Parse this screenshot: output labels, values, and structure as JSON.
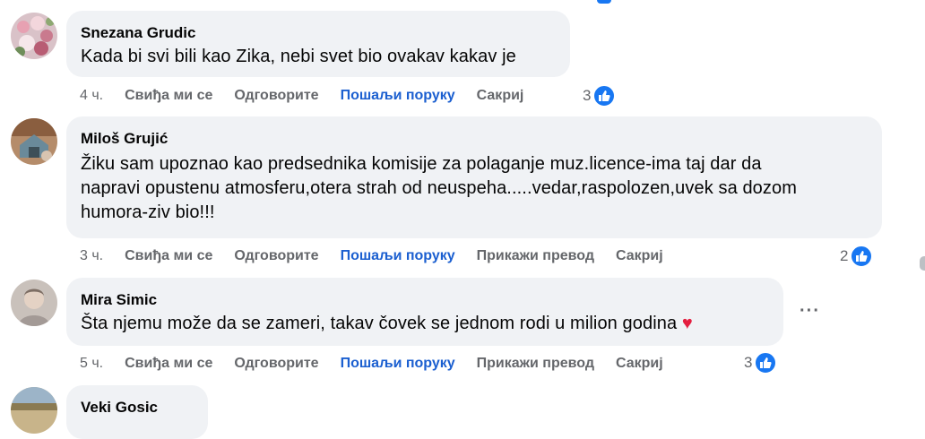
{
  "comments": [
    {
      "author": "Snezana Grudic",
      "text": "Kada bi svi bili kao Zika, nebi svet bio ovakav kakav je",
      "time": "4 ч.",
      "like": "Свиђа ми се",
      "reply": "Одговорите",
      "message": "Пошаљи поруку",
      "hide": "Сакриј",
      "reactions": "3"
    },
    {
      "author": "Miloš Grujić",
      "text_lines": [
        "Žiku sam upoznao kao predsednika komisije za polaganje muz.licence-ima taj dar da",
        "napravi opustenu atmosferu,otera strah od neuspeha.....vedar,raspolozen,uvek sa dozom",
        "humora-ziv bio!!!"
      ],
      "time": "3 ч.",
      "like": "Свиђа ми се",
      "reply": "Одговорите",
      "message": "Пошаљи поруку",
      "translate": "Прикажи превод",
      "hide": "Сакриј",
      "reactions": "2"
    },
    {
      "author": "Mira Simic",
      "text": "Šta njemu može da se zameri, takav čovek se jednom rodi u milion godina",
      "emoji": "♥",
      "time": "5 ч.",
      "like": "Свиђа ми се",
      "reply": "Одговорите",
      "message": "Пошаљи поруку",
      "translate": "Прикажи превод",
      "hide": "Сакриј",
      "reactions": "3",
      "menu": "···"
    },
    {
      "author": "Veki Gosic"
    }
  ],
  "colors": {
    "bubble": "#f0f2f5",
    "link_blue": "#1b5fd0",
    "like_blue": "#1877f2",
    "secondary_text": "#65676b"
  }
}
